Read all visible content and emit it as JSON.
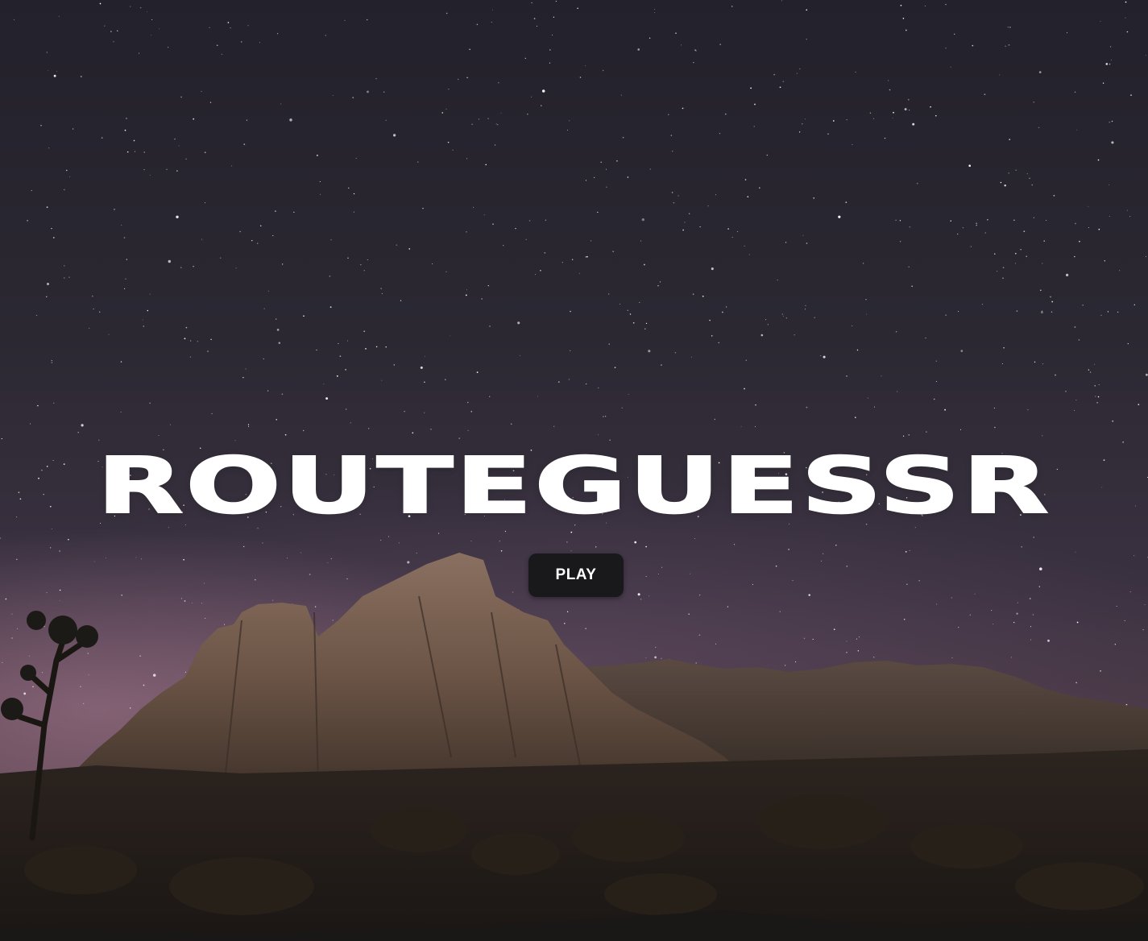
{
  "background": {
    "scene": "night-sky-desert",
    "sky_color": "#2b2832",
    "horizon_glow_color": "#b08096",
    "rock_color": "#7a6152"
  },
  "hero": {
    "title": "ROUTEGUESSR",
    "play_label": "PLAY"
  },
  "colors": {
    "title_text": "#ffffff",
    "button_background": "#19181b",
    "button_text": "#ffffff"
  }
}
